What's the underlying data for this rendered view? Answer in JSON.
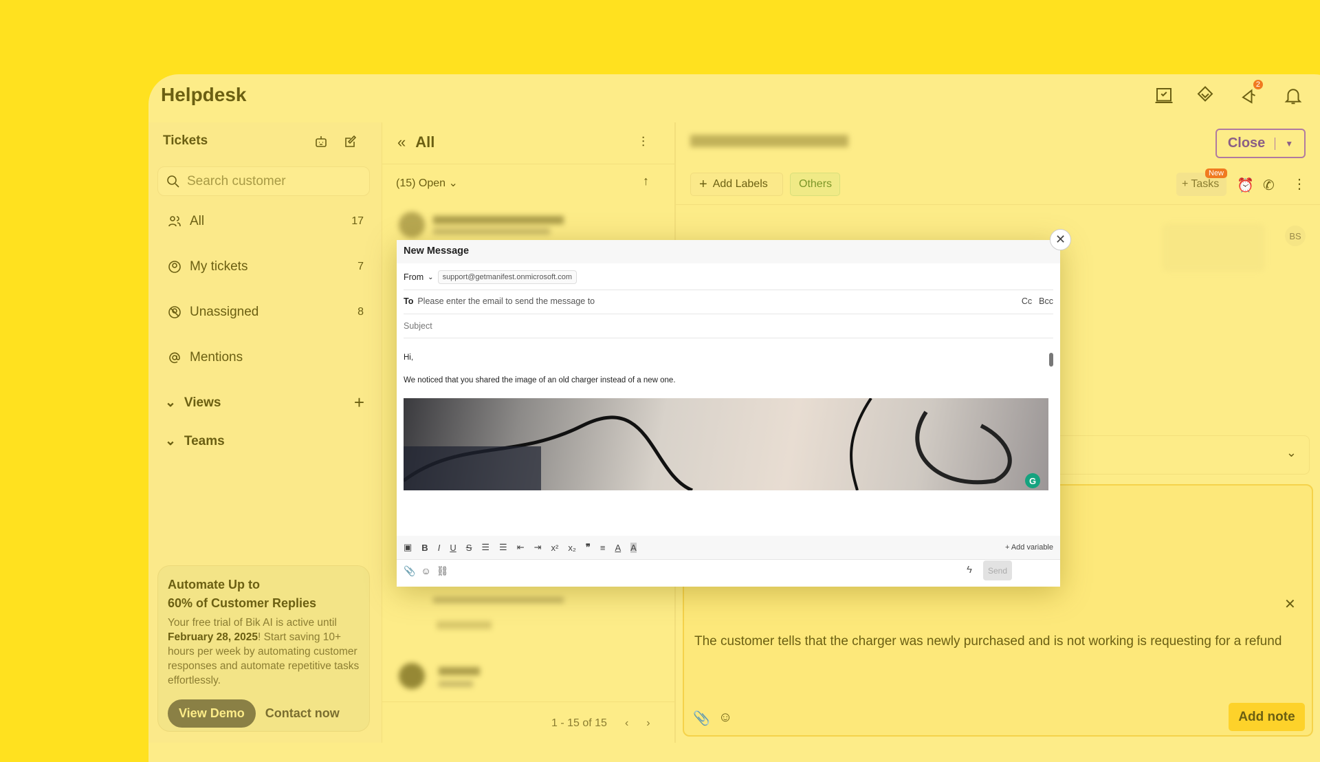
{
  "app": {
    "title": "Helpdesk",
    "notification_count": "2"
  },
  "sidebar": {
    "header": "Tickets",
    "search_placeholder": "Search customer",
    "items": [
      {
        "label": "All",
        "count": "17"
      },
      {
        "label": "My tickets",
        "count": "7"
      },
      {
        "label": "Unassigned",
        "count": "8"
      },
      {
        "label": "Mentions",
        "count": ""
      }
    ],
    "views": "Views",
    "teams": "Teams",
    "promo": {
      "title_line1": "Automate Up to",
      "title_line2": "60% of Customer Replies",
      "body_pre": "Your free trial of Bik AI is active until ",
      "body_date": "February 28, 2025",
      "body_post": "! Start saving 10+ hours per week by automating customer responses and automate repetitive tasks effortlessly.",
      "view_demo": "View Demo",
      "contact_now": "Contact now"
    }
  },
  "list": {
    "title": "All",
    "filter": "(15) Open",
    "pagination": "1 - 15 of 15"
  },
  "ticket": {
    "close_label": "Close",
    "add_labels": "Add Labels",
    "label_others": "Others",
    "tasks": "Tasks",
    "tasks_badge": "New",
    "avatar_initials": "BS",
    "note_text": "The customer tells that the charger was newly purchased and is not working is requesting for a refund",
    "add_note": "Add note"
  },
  "compose": {
    "title": "New Message",
    "from_label": "From",
    "from_value": "support@getmanifest.onmicrosoft.com",
    "to_label": "To",
    "to_placeholder": "Please enter the email to send the message to",
    "cc": "Cc",
    "bcc": "Bcc",
    "subject_placeholder": "Subject",
    "body_greeting": "Hi,",
    "body_line": "We noticed that you shared the image of an old charger instead of a new one.",
    "add_variable": "Add variable",
    "send": "Send"
  }
}
